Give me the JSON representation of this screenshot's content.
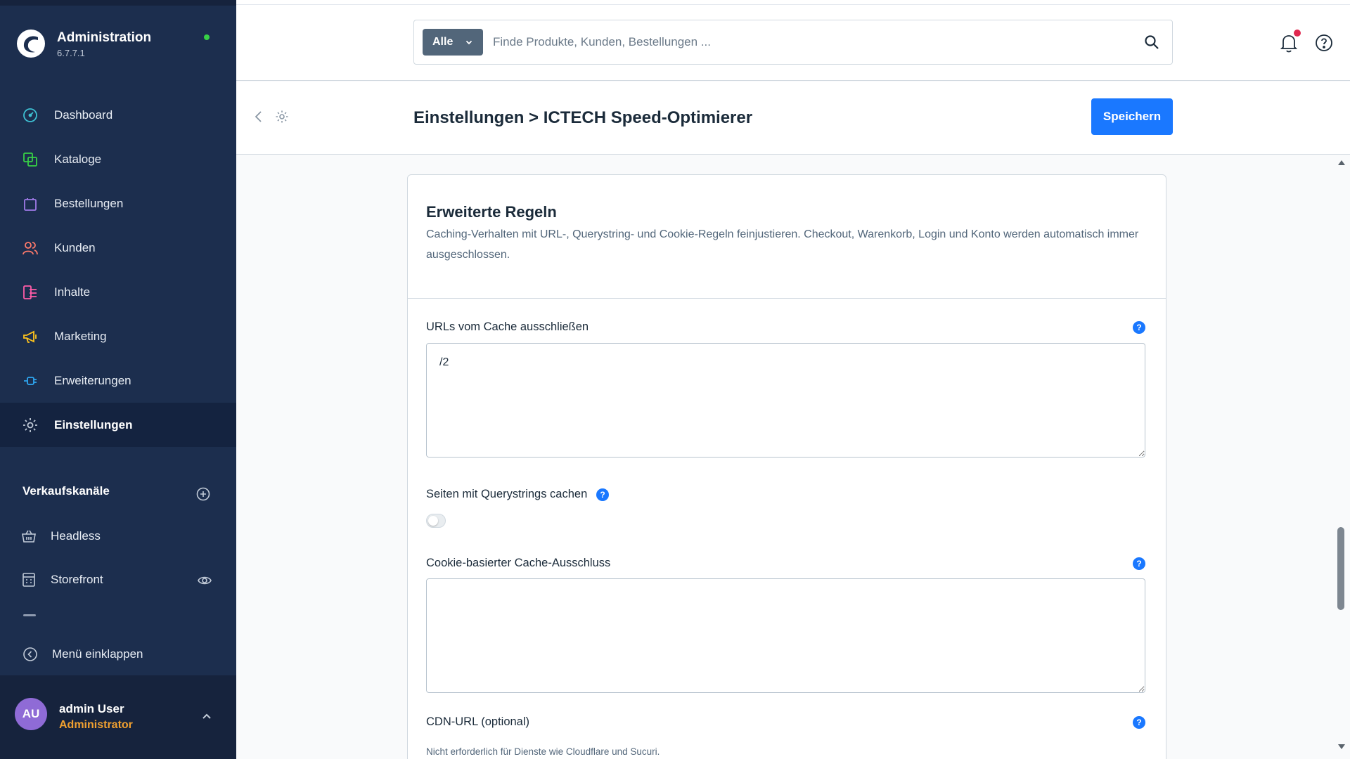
{
  "app": {
    "name": "Administration",
    "version": "6.7.7.1"
  },
  "nav": {
    "items": [
      {
        "label": "Dashboard"
      },
      {
        "label": "Kataloge"
      },
      {
        "label": "Bestellungen"
      },
      {
        "label": "Kunden"
      },
      {
        "label": "Inhalte"
      },
      {
        "label": "Marketing"
      },
      {
        "label": "Erweiterungen"
      },
      {
        "label": "Einstellungen"
      }
    ],
    "active": "Einstellungen"
  },
  "sales_channels": {
    "title": "Verkaufskanäle",
    "items": [
      {
        "label": "Headless"
      },
      {
        "label": "Storefront"
      }
    ]
  },
  "collapse_menu": {
    "label": "Menü einklappen"
  },
  "user": {
    "initials": "AU",
    "name": "admin User",
    "role": "Administrator"
  },
  "search": {
    "type_label": "Alle",
    "placeholder": "Finde Produkte, Kunden, Bestellungen ..."
  },
  "smartbar": {
    "title": "Einstellungen > ICTECH Speed-Optimierer",
    "save_label": "Speichern"
  },
  "card": {
    "title": "Erweiterte Regeln",
    "description": "Caching-Verhalten mit URL-, Querystring- und Cookie-Regeln feinjustieren. Checkout, Warenkorb, Login und Konto werden automatisch immer ausgeschlossen.",
    "fields": {
      "exclude_urls": {
        "label": "URLs vom Cache ausschließen",
        "value": "/2"
      },
      "cache_querystrings": {
        "label": "Seiten mit Querystrings cachen",
        "enabled": false
      },
      "cookie_exclusion": {
        "label": "Cookie-basierter Cache-Ausschluss",
        "value": ""
      },
      "cdn_url": {
        "label": "CDN-URL (optional)",
        "hint": "Nicht erforderlich für Dienste wie Cloudflare und Sucuri."
      }
    },
    "help_glyph": "?"
  },
  "colors": {
    "sidebar": "#1c2e4e",
    "accent": "#1a78ff",
    "status_online": "#37d046",
    "notification": "#e0284f",
    "role": "#f0a030"
  }
}
